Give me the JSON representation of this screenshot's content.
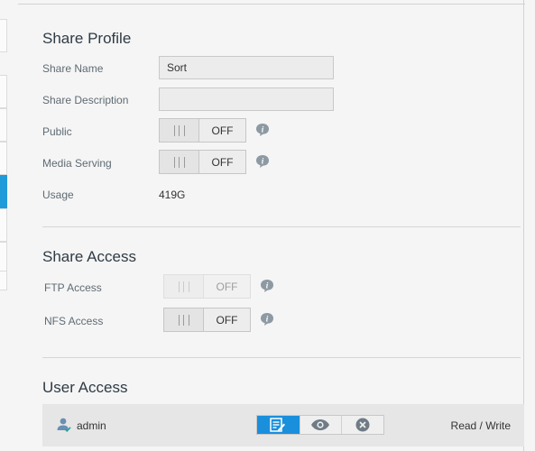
{
  "share_profile": {
    "title": "Share Profile",
    "share_name_label": "Share Name",
    "share_name_value": "Sort",
    "share_description_label": "Share Description",
    "share_description_value": "",
    "public_label": "Public",
    "public_state": "OFF",
    "media_serving_label": "Media Serving",
    "media_serving_state": "OFF",
    "usage_label": "Usage",
    "usage_value": "419G"
  },
  "share_access": {
    "title": "Share Access",
    "ftp_label": "FTP Access",
    "ftp_state": "OFF",
    "nfs_label": "NFS Access",
    "nfs_state": "OFF"
  },
  "user_access": {
    "title": "User Access",
    "users": [
      {
        "name": "admin",
        "permission": "Read / Write"
      }
    ]
  },
  "colors": {
    "accent": "#1a8fdc",
    "sidebar_active": "#1f9bd9"
  }
}
